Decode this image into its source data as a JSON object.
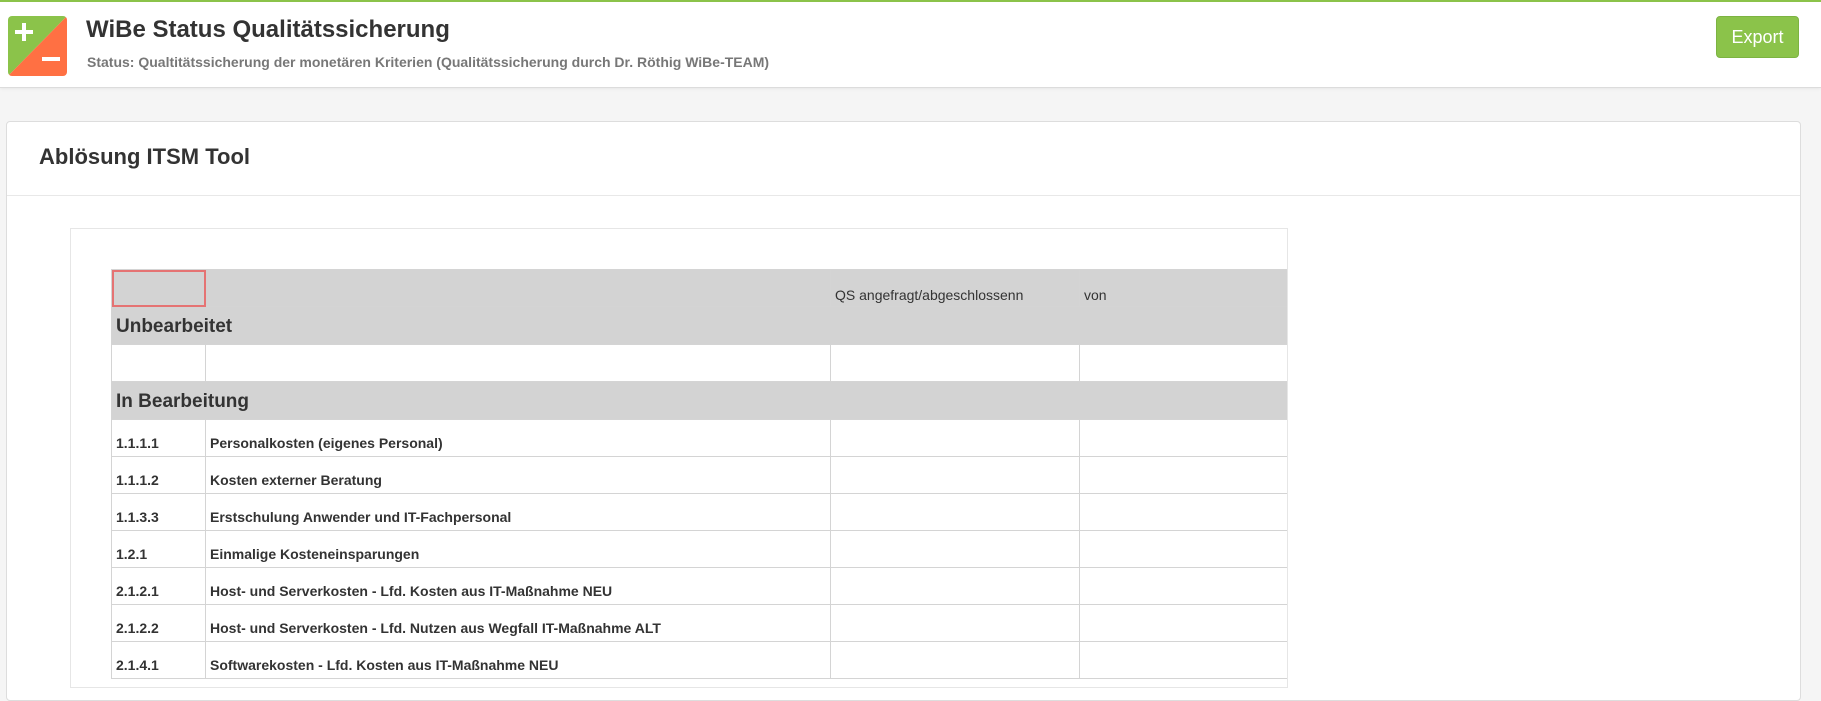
{
  "header": {
    "title": "WiBe Status Qualitätssicherung",
    "status": "Status: Qualtitätssicherung der monetären Kriterien (Qualitätssicherung durch Dr. Röthig WiBe-TEAM)",
    "export_label": "Export",
    "logo_icon": "plus-minus-icon",
    "accent_color": "#8bc34a",
    "logo_colors": {
      "plus": "#8bc34a",
      "minus": "#ff7043"
    }
  },
  "panel": {
    "title": "Ablösung ITSM Tool"
  },
  "table": {
    "headers": [
      "",
      "",
      "QS angefragt/abgeschlossenn",
      "von"
    ],
    "sections": [
      {
        "title": "Unbearbeitet",
        "rows": [
          {
            "code": "",
            "name": "",
            "qs": "",
            "von": ""
          }
        ]
      },
      {
        "title": "In Bearbeitung",
        "rows": [
          {
            "code": "1.1.1.1",
            "name": "Personalkosten (eigenes Personal)",
            "qs": "",
            "von": ""
          },
          {
            "code": "1.1.1.2",
            "name": "Kosten externer Beratung",
            "qs": "",
            "von": ""
          },
          {
            "code": "1.1.3.3",
            "name": "Erstschulung Anwender und IT-Fachpersonal",
            "qs": "",
            "von": ""
          },
          {
            "code": "1.2.1",
            "name": "Einmalige Kosteneinsparungen",
            "qs": "",
            "von": ""
          },
          {
            "code": "2.1.2.1",
            "name": "Host- und Serverkosten - Lfd. Kosten aus IT-Maßnahme NEU",
            "qs": "",
            "von": ""
          },
          {
            "code": "2.1.2.2",
            "name": "Host- und Serverkosten - Lfd. Nutzen aus Wegfall IT-Maßnahme ALT",
            "qs": "",
            "von": ""
          },
          {
            "code": "2.1.4.1",
            "name": "Softwarekosten - Lfd. Kosten aus IT-Maßnahme NEU",
            "qs": "",
            "von": ""
          }
        ]
      }
    ]
  }
}
